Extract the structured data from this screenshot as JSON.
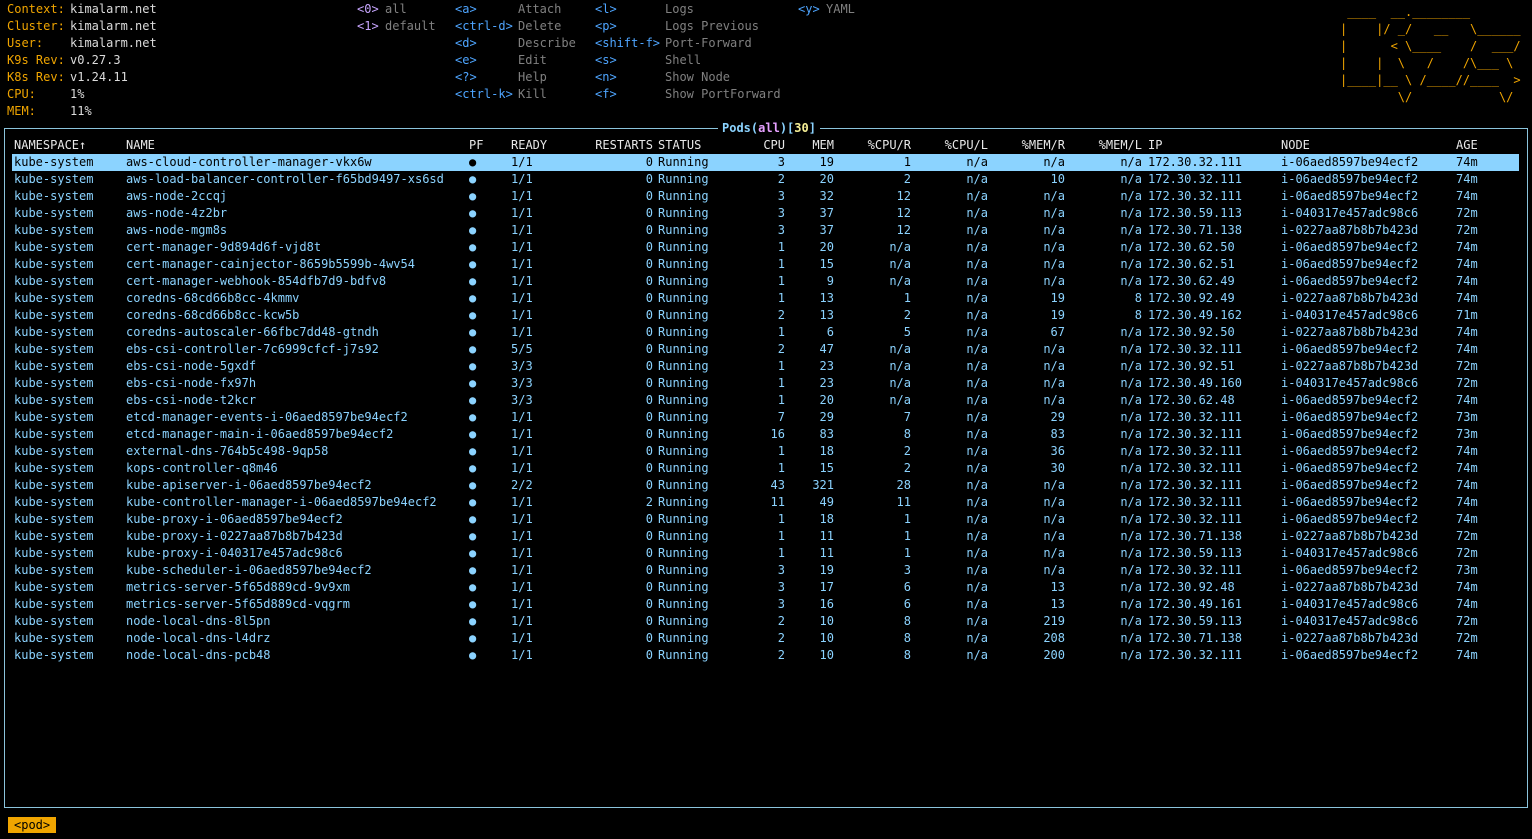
{
  "info": [
    {
      "key": "Context:",
      "value": "kimalarm.net"
    },
    {
      "key": "Cluster:",
      "value": "kimalarm.net"
    },
    {
      "key": "User:",
      "value": "kimalarm.net"
    },
    {
      "key": "K9s Rev:",
      "value": "v0.27.3"
    },
    {
      "key": "K8s Rev:",
      "value": "v1.24.11"
    },
    {
      "key": "CPU:",
      "value": "1%"
    },
    {
      "key": "MEM:",
      "value": "11%"
    }
  ],
  "namespaces": [
    {
      "key": "<0>",
      "label": "all"
    },
    {
      "key": "<1>",
      "label": "default"
    }
  ],
  "menu_col1": [
    {
      "key": "<a>",
      "label": "Attach"
    },
    {
      "key": "<ctrl-d>",
      "label": "Delete"
    },
    {
      "key": "<d>",
      "label": "Describe"
    },
    {
      "key": "<e>",
      "label": "Edit"
    },
    {
      "key": "<?>",
      "label": "Help"
    },
    {
      "key": "<ctrl-k>",
      "label": "Kill"
    }
  ],
  "menu_col2": [
    {
      "key": "<l>",
      "label": "Logs"
    },
    {
      "key": "<p>",
      "label": "Logs Previous"
    },
    {
      "key": "<shift-f>",
      "label": "Port-Forward"
    },
    {
      "key": "<s>",
      "label": "Shell"
    },
    {
      "key": "<n>",
      "label": "Show Node"
    },
    {
      "key": "<f>",
      "label": "Show PortForward"
    }
  ],
  "menu_col3": [
    {
      "key": "<y>",
      "label": "YAML"
    }
  ],
  "logo_lines": [
    " ____  __.________        ",
    "|    |/ _/   __   \\______ ",
    "|      < \\____    /  ___/ ",
    "|    |  \\   /    /\\___ \\  ",
    "|____|__ \\ /____//____  > ",
    "        \\/            \\/  "
  ],
  "title": {
    "resource": "Pods",
    "ns": "all",
    "count": "30"
  },
  "columns": [
    "NAMESPACE↑",
    "NAME",
    "PF",
    "READY",
    "RESTARTS",
    "STATUS",
    "CPU",
    "MEM",
    "%CPU/R",
    "%CPU/L",
    "%MEM/R",
    "%MEM/L",
    "IP",
    "NODE",
    "AGE"
  ],
  "rows": [
    [
      "kube-system",
      "aws-cloud-controller-manager-vkx6w",
      "●",
      "1/1",
      "0",
      "Running",
      "3",
      "19",
      "1",
      "n/a",
      "n/a",
      "n/a",
      "172.30.32.111",
      "i-06aed8597be94ecf2",
      "74m"
    ],
    [
      "kube-system",
      "aws-load-balancer-controller-f65bd9497-xs6sd",
      "●",
      "1/1",
      "0",
      "Running",
      "2",
      "20",
      "2",
      "n/a",
      "10",
      "n/a",
      "172.30.32.111",
      "i-06aed8597be94ecf2",
      "74m"
    ],
    [
      "kube-system",
      "aws-node-2ccqj",
      "●",
      "1/1",
      "0",
      "Running",
      "3",
      "32",
      "12",
      "n/a",
      "n/a",
      "n/a",
      "172.30.32.111",
      "i-06aed8597be94ecf2",
      "74m"
    ],
    [
      "kube-system",
      "aws-node-4z2br",
      "●",
      "1/1",
      "0",
      "Running",
      "3",
      "37",
      "12",
      "n/a",
      "n/a",
      "n/a",
      "172.30.59.113",
      "i-040317e457adc98c6",
      "72m"
    ],
    [
      "kube-system",
      "aws-node-mgm8s",
      "●",
      "1/1",
      "0",
      "Running",
      "3",
      "37",
      "12",
      "n/a",
      "n/a",
      "n/a",
      "172.30.71.138",
      "i-0227aa87b8b7b423d",
      "72m"
    ],
    [
      "kube-system",
      "cert-manager-9d894d6f-vjd8t",
      "●",
      "1/1",
      "0",
      "Running",
      "1",
      "20",
      "n/a",
      "n/a",
      "n/a",
      "n/a",
      "172.30.62.50",
      "i-06aed8597be94ecf2",
      "74m"
    ],
    [
      "kube-system",
      "cert-manager-cainjector-8659b5599b-4wv54",
      "●",
      "1/1",
      "0",
      "Running",
      "1",
      "15",
      "n/a",
      "n/a",
      "n/a",
      "n/a",
      "172.30.62.51",
      "i-06aed8597be94ecf2",
      "74m"
    ],
    [
      "kube-system",
      "cert-manager-webhook-854dfb7d9-bdfv8",
      "●",
      "1/1",
      "0",
      "Running",
      "1",
      "9",
      "n/a",
      "n/a",
      "n/a",
      "n/a",
      "172.30.62.49",
      "i-06aed8597be94ecf2",
      "74m"
    ],
    [
      "kube-system",
      "coredns-68cd66b8cc-4kmmv",
      "●",
      "1/1",
      "0",
      "Running",
      "1",
      "13",
      "1",
      "n/a",
      "19",
      "8",
      "172.30.92.49",
      "i-0227aa87b8b7b423d",
      "74m"
    ],
    [
      "kube-system",
      "coredns-68cd66b8cc-kcw5b",
      "●",
      "1/1",
      "0",
      "Running",
      "2",
      "13",
      "2",
      "n/a",
      "19",
      "8",
      "172.30.49.162",
      "i-040317e457adc98c6",
      "71m"
    ],
    [
      "kube-system",
      "coredns-autoscaler-66fbc7dd48-gtndh",
      "●",
      "1/1",
      "0",
      "Running",
      "1",
      "6",
      "5",
      "n/a",
      "67",
      "n/a",
      "172.30.92.50",
      "i-0227aa87b8b7b423d",
      "74m"
    ],
    [
      "kube-system",
      "ebs-csi-controller-7c6999cfcf-j7s92",
      "●",
      "5/5",
      "0",
      "Running",
      "2",
      "47",
      "n/a",
      "n/a",
      "n/a",
      "n/a",
      "172.30.32.111",
      "i-06aed8597be94ecf2",
      "74m"
    ],
    [
      "kube-system",
      "ebs-csi-node-5gxdf",
      "●",
      "3/3",
      "0",
      "Running",
      "1",
      "23",
      "n/a",
      "n/a",
      "n/a",
      "n/a",
      "172.30.92.51",
      "i-0227aa87b8b7b423d",
      "72m"
    ],
    [
      "kube-system",
      "ebs-csi-node-fx97h",
      "●",
      "3/3",
      "0",
      "Running",
      "1",
      "23",
      "n/a",
      "n/a",
      "n/a",
      "n/a",
      "172.30.49.160",
      "i-040317e457adc98c6",
      "72m"
    ],
    [
      "kube-system",
      "ebs-csi-node-t2kcr",
      "●",
      "3/3",
      "0",
      "Running",
      "1",
      "20",
      "n/a",
      "n/a",
      "n/a",
      "n/a",
      "172.30.62.48",
      "i-06aed8597be94ecf2",
      "74m"
    ],
    [
      "kube-system",
      "etcd-manager-events-i-06aed8597be94ecf2",
      "●",
      "1/1",
      "0",
      "Running",
      "7",
      "29",
      "7",
      "n/a",
      "29",
      "n/a",
      "172.30.32.111",
      "i-06aed8597be94ecf2",
      "73m"
    ],
    [
      "kube-system",
      "etcd-manager-main-i-06aed8597be94ecf2",
      "●",
      "1/1",
      "0",
      "Running",
      "16",
      "83",
      "8",
      "n/a",
      "83",
      "n/a",
      "172.30.32.111",
      "i-06aed8597be94ecf2",
      "73m"
    ],
    [
      "kube-system",
      "external-dns-764b5c498-9qp58",
      "●",
      "1/1",
      "0",
      "Running",
      "1",
      "18",
      "2",
      "n/a",
      "36",
      "n/a",
      "172.30.32.111",
      "i-06aed8597be94ecf2",
      "74m"
    ],
    [
      "kube-system",
      "kops-controller-q8m46",
      "●",
      "1/1",
      "0",
      "Running",
      "1",
      "15",
      "2",
      "n/a",
      "30",
      "n/a",
      "172.30.32.111",
      "i-06aed8597be94ecf2",
      "74m"
    ],
    [
      "kube-system",
      "kube-apiserver-i-06aed8597be94ecf2",
      "●",
      "2/2",
      "0",
      "Running",
      "43",
      "321",
      "28",
      "n/a",
      "n/a",
      "n/a",
      "172.30.32.111",
      "i-06aed8597be94ecf2",
      "74m"
    ],
    [
      "kube-system",
      "kube-controller-manager-i-06aed8597be94ecf2",
      "●",
      "1/1",
      "2",
      "Running",
      "11",
      "49",
      "11",
      "n/a",
      "n/a",
      "n/a",
      "172.30.32.111",
      "i-06aed8597be94ecf2",
      "74m"
    ],
    [
      "kube-system",
      "kube-proxy-i-06aed8597be94ecf2",
      "●",
      "1/1",
      "0",
      "Running",
      "1",
      "18",
      "1",
      "n/a",
      "n/a",
      "n/a",
      "172.30.32.111",
      "i-06aed8597be94ecf2",
      "74m"
    ],
    [
      "kube-system",
      "kube-proxy-i-0227aa87b8b7b423d",
      "●",
      "1/1",
      "0",
      "Running",
      "1",
      "11",
      "1",
      "n/a",
      "n/a",
      "n/a",
      "172.30.71.138",
      "i-0227aa87b8b7b423d",
      "72m"
    ],
    [
      "kube-system",
      "kube-proxy-i-040317e457adc98c6",
      "●",
      "1/1",
      "0",
      "Running",
      "1",
      "11",
      "1",
      "n/a",
      "n/a",
      "n/a",
      "172.30.59.113",
      "i-040317e457adc98c6",
      "72m"
    ],
    [
      "kube-system",
      "kube-scheduler-i-06aed8597be94ecf2",
      "●",
      "1/1",
      "0",
      "Running",
      "3",
      "19",
      "3",
      "n/a",
      "n/a",
      "n/a",
      "172.30.32.111",
      "i-06aed8597be94ecf2",
      "73m"
    ],
    [
      "kube-system",
      "metrics-server-5f65d889cd-9v9xm",
      "●",
      "1/1",
      "0",
      "Running",
      "3",
      "17",
      "6",
      "n/a",
      "13",
      "n/a",
      "172.30.92.48",
      "i-0227aa87b8b7b423d",
      "74m"
    ],
    [
      "kube-system",
      "metrics-server-5f65d889cd-vqgrm",
      "●",
      "1/1",
      "0",
      "Running",
      "3",
      "16",
      "6",
      "n/a",
      "13",
      "n/a",
      "172.30.49.161",
      "i-040317e457adc98c6",
      "74m"
    ],
    [
      "kube-system",
      "node-local-dns-8l5pn",
      "●",
      "1/1",
      "0",
      "Running",
      "2",
      "10",
      "8",
      "n/a",
      "219",
      "n/a",
      "172.30.59.113",
      "i-040317e457adc98c6",
      "72m"
    ],
    [
      "kube-system",
      "node-local-dns-l4drz",
      "●",
      "1/1",
      "0",
      "Running",
      "2",
      "10",
      "8",
      "n/a",
      "208",
      "n/a",
      "172.30.71.138",
      "i-0227aa87b8b7b423d",
      "72m"
    ],
    [
      "kube-system",
      "node-local-dns-pcb48",
      "●",
      "1/1",
      "0",
      "Running",
      "2",
      "10",
      "8",
      "n/a",
      "200",
      "n/a",
      "172.30.32.111",
      "i-06aed8597be94ecf2",
      "74m"
    ]
  ],
  "selected_row": 0,
  "breadcrumb": "<pod>"
}
